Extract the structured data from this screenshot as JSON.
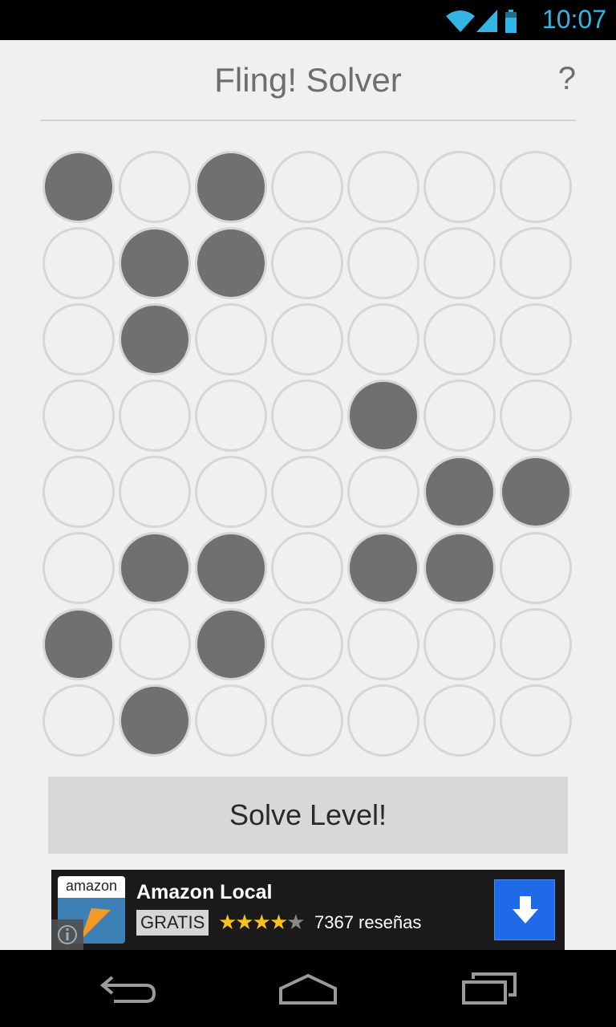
{
  "status_bar": {
    "time": "10:07"
  },
  "header": {
    "title": "Fling! Solver",
    "help_label": "?"
  },
  "board": {
    "rows": 8,
    "cols": 7,
    "filled": [
      [
        true,
        false,
        true,
        false,
        false,
        false,
        false
      ],
      [
        false,
        true,
        true,
        false,
        false,
        false,
        false
      ],
      [
        false,
        true,
        false,
        false,
        false,
        false,
        false
      ],
      [
        false,
        false,
        false,
        false,
        true,
        false,
        false
      ],
      [
        false,
        false,
        false,
        false,
        false,
        true,
        true
      ],
      [
        false,
        true,
        true,
        false,
        true,
        true,
        false
      ],
      [
        true,
        false,
        true,
        false,
        false,
        false,
        false
      ],
      [
        false,
        true,
        false,
        false,
        false,
        false,
        false
      ]
    ]
  },
  "solve_button": {
    "label": "Solve Level!"
  },
  "ad": {
    "logo_text": "amazon",
    "title": "Amazon Local",
    "badge": "GRATIS",
    "rating": 4.5,
    "reviews": "7367 reseñas"
  },
  "navbar": {
    "buttons": [
      "back",
      "home",
      "recent-apps"
    ]
  }
}
